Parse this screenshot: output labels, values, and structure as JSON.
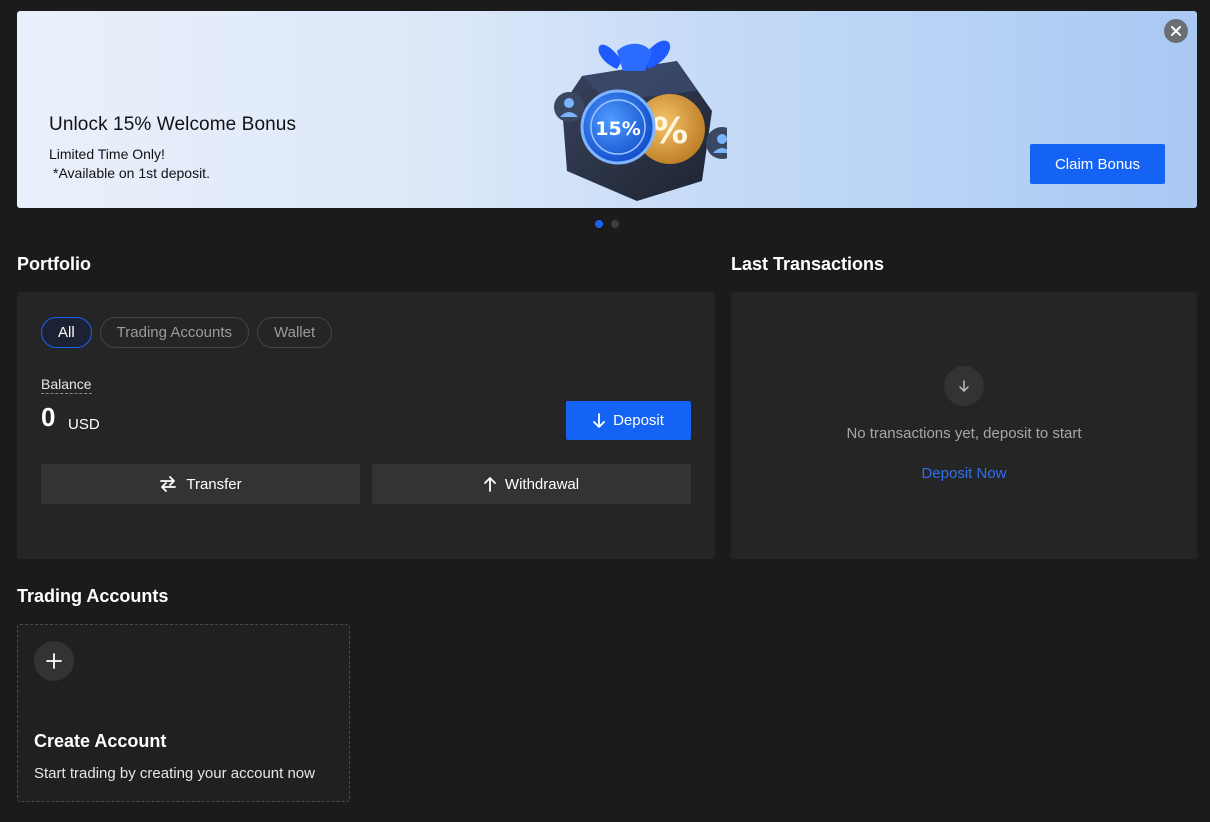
{
  "banner": {
    "title": "Unlock 15% Welcome Bonus",
    "subtitle_line1": "Limited Time Only!",
    "subtitle_line2": "*Available on 1st deposit.",
    "cta_label": "Claim Bonus",
    "badge_text": "15%",
    "badge_secondary": "%",
    "close_icon": "close-icon",
    "slides_total": 2,
    "active_slide": 1
  },
  "portfolio": {
    "title": "Portfolio",
    "filters": [
      {
        "label": "All",
        "active": true
      },
      {
        "label": "Trading Accounts",
        "active": false
      },
      {
        "label": "Wallet",
        "active": false
      }
    ],
    "balance_label": "Balance",
    "balance_value": "0",
    "balance_currency": "USD",
    "deposit_label": "Deposit",
    "transfer_label": "Transfer",
    "withdrawal_label": "Withdrawal"
  },
  "transactions": {
    "title": "Last Transactions",
    "empty_text": "No transactions yet, deposit to start",
    "cta_label": "Deposit Now"
  },
  "trading_accounts": {
    "title": "Trading Accounts",
    "create_title": "Create Account",
    "create_subtitle": "Start trading by creating your account now"
  },
  "colors": {
    "background": "#1b1b1b",
    "card": "#252525",
    "accent": "#1463f5",
    "link": "#2e6ff0",
    "muted_text": "#a6a6a6"
  }
}
